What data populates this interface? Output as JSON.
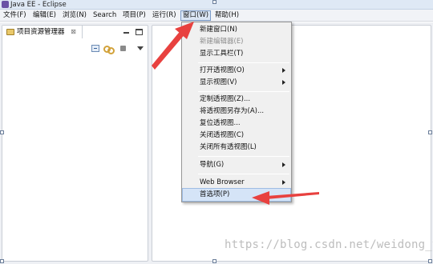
{
  "window": {
    "title": "Java EE - Eclipse"
  },
  "menubar": {
    "items": [
      {
        "label": "文件(F)"
      },
      {
        "label": "编辑(E)"
      },
      {
        "label": "浏览(N)"
      },
      {
        "label": "Search"
      },
      {
        "label": "项目(P)"
      },
      {
        "label": "运行(R)"
      },
      {
        "label": "窗口(W)",
        "active": true
      },
      {
        "label": "帮助(H)"
      }
    ]
  },
  "project_explorer": {
    "title": "项目资源管理器",
    "close_glyph": "⊠",
    "toolbar_icons": [
      "collapse-all-icon",
      "link-editor-icon",
      "focus-icon",
      "view-menu-icon"
    ]
  },
  "window_menu": {
    "items": [
      {
        "label": "新建窗口(N)"
      },
      {
        "label": "新建编辑器(E)",
        "disabled": true
      },
      {
        "label": "显示工具栏(T)"
      },
      {
        "label": "打开透视图(O)",
        "submenu": true
      },
      {
        "label": "显示视图(V)",
        "submenu": true
      },
      {
        "label": "定制透视图(Z)..."
      },
      {
        "label": "将透视图另存为(A)..."
      },
      {
        "label": "复位透视图..."
      },
      {
        "label": "关闭透视图(C)"
      },
      {
        "label": "关闭所有透视图(L)"
      },
      {
        "label": "导航(G)",
        "submenu": true
      },
      {
        "label": "Web Browser",
        "submenu": true
      },
      {
        "label": "首选项(P)",
        "highlighted": true
      }
    ]
  },
  "annotation": {
    "arrow_color": "#e8413f"
  },
  "watermark": {
    "text": "https://blog.csdn.net/weidong_y"
  }
}
